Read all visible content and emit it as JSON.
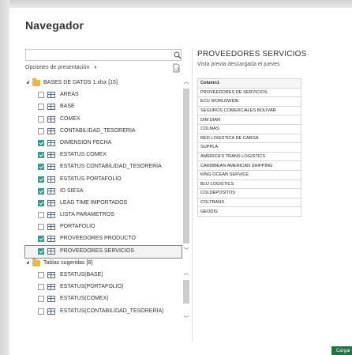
{
  "title": "Navegador",
  "search": {
    "value": "",
    "placeholder": ""
  },
  "options": {
    "label": "Opciones de presentación",
    "chevron": "▾"
  },
  "tree": {
    "root1": {
      "label": "BASES DE DATOS 1.xlsx [15]",
      "expanded": true
    },
    "items1": [
      {
        "label": "AREAS",
        "checked": false
      },
      {
        "label": "BASE",
        "checked": false
      },
      {
        "label": "COMEX",
        "checked": false
      },
      {
        "label": "CONTABILIDAD_TESORERIA",
        "checked": false
      },
      {
        "label": "DIMENSION FECHA",
        "checked": true
      },
      {
        "label": "ESTATUS COMEX",
        "checked": true
      },
      {
        "label": "ESTATUS CONTABILIDAD_TESORERIA",
        "checked": true
      },
      {
        "label": "ESTATUS PORTAFOLIO",
        "checked": true
      },
      {
        "label": "ID SIESA",
        "checked": true
      },
      {
        "label": "LEAD TIME IMPORTADOS",
        "checked": true
      },
      {
        "label": "LISTA PARAMETROS",
        "checked": false
      },
      {
        "label": "PORTAFOLIO",
        "checked": false
      },
      {
        "label": "PROVEEDORES PRODUCTO",
        "checked": true
      },
      {
        "label": "PROVEEDORES SERVICIOS",
        "checked": true,
        "selected": true
      }
    ],
    "root2": {
      "label": "Tablas sugeridas [8]",
      "expanded": true
    },
    "items2": [
      {
        "label": "ESTATUS(BASE)",
        "checked": false
      },
      {
        "label": "ESTATUS(PORTAFOLIO)",
        "checked": false
      },
      {
        "label": "ESTATUS(COMEX)",
        "checked": false
      },
      {
        "label": "ESTATUS(CONTABILIDAD_TESORERIA)",
        "checked": false
      }
    ]
  },
  "preview": {
    "title": "PROVEEDORES SERVICIOS",
    "subtitle": "Vista previa descargada el jueves",
    "column": "Column1",
    "rows": [
      "PROVEEDORES DE SERVICIOS",
      "ECU WORLDWIDE",
      "SEGUROS COMERCIALES BOLIVAR",
      "DIM DIAN",
      "COLMAS",
      "RED LOGISTICA DE CARGA",
      "SUPPLA",
      "AMERICA'S TRANS LOGISTICS",
      "CARIBBEAN AMERICAN SHIPPING",
      "KING OCEAN SERVICE",
      "BLU LOGISTICS",
      "COLDEPOSITOS",
      "COLTRANS",
      "GEODIS"
    ]
  },
  "footer": {
    "load_label": "Cargar"
  },
  "colors": {
    "accent": "#217346",
    "checkbox": "#3a9a8f",
    "folder": "#e8b84a"
  },
  "icons": {
    "search": "search-icon",
    "refresh": "refresh-icon",
    "folder": "folder-icon",
    "table": "table-icon"
  }
}
